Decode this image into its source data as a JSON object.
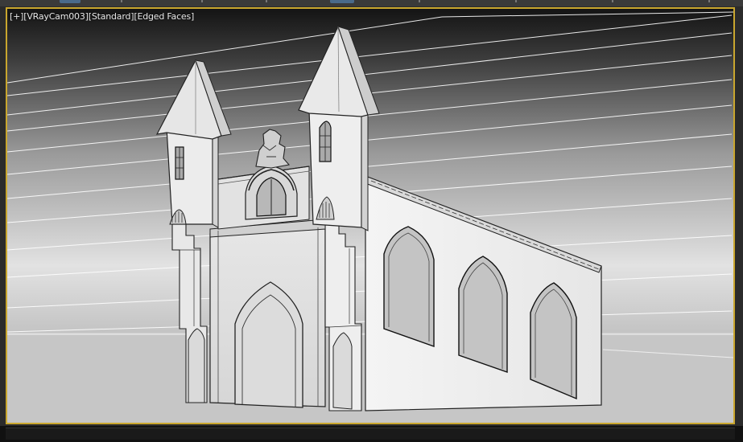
{
  "viewport": {
    "label_parts": [
      "[",
      "+",
      "]",
      "[",
      "VRayCam003",
      "]",
      "[",
      "Standard",
      "]",
      "[",
      "Edged Faces",
      "]"
    ],
    "active_border_color": "#c9a62e"
  },
  "scene": {
    "object": "church-ruin-model",
    "shading": "Edged Faces"
  }
}
